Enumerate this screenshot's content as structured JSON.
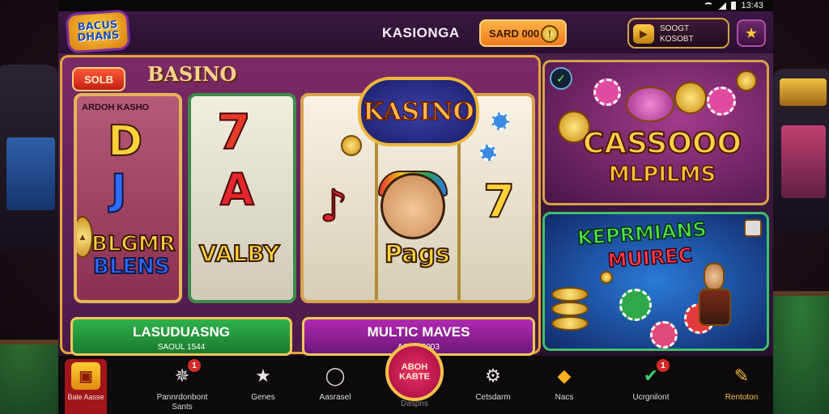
{
  "status_bar": {
    "time": "13:43"
  },
  "header": {
    "logo_line1": "BACUS",
    "logo_line2": "DHANS",
    "title": "KASIONGA",
    "coin_button_label": "SARD 000",
    "profile_line1": "SOOGT",
    "profile_line2": "KOSOBT",
    "icons": {
      "coin": "coin-icon",
      "profile": "ticket-icon",
      "star": "star-icon"
    }
  },
  "slot": {
    "badge": "SOLB",
    "top_name": "BASINO",
    "reel1_label": "ARDOH KASHO",
    "reel1_symbols": [
      "D",
      "J",
      "BLGMR",
      "BLENS"
    ],
    "reel2_symbols": [
      "7",
      "A",
      "VALBY"
    ],
    "kasino_badge": "KASINO",
    "reel3_symbols": [
      "7",
      "Pags"
    ]
  },
  "buttons": {
    "green_title": "LASUDUASNG",
    "green_sub": "SAOUL 1544",
    "purple_title": "MULTIC MAVES",
    "purple_sub": "AOUL 0003"
  },
  "promos": {
    "promo1_title": "CASSOOO",
    "promo1_sub": "MLPILMS",
    "promo2_title": "KEPRMIANS",
    "promo2_sub": "MUIREC"
  },
  "nav": {
    "home_label": "Bale Aasse",
    "items": [
      {
        "label": "Pannrdonbont Sants",
        "icon": "rocket-icon",
        "badge": "1"
      },
      {
        "label": "Genes",
        "icon": "star-icon"
      },
      {
        "label": "Aasrasel",
        "icon": "chat-bubble-icon"
      },
      {
        "label": "Cetsdarm",
        "icon": "gear-icon"
      },
      {
        "label": "Nacs",
        "icon": "diamond-icon"
      },
      {
        "label": "Ucrgnilont",
        "icon": "trophy-icon",
        "badge": "1"
      },
      {
        "label": "Rentoton",
        "icon": "thumbs-up-icon"
      }
    ],
    "center_line1": "ABOH",
    "center_line2": "KABTE",
    "center_label": "Daspns"
  },
  "colors": {
    "accent_gold": "#e5a53a",
    "accent_pink": "#e8306a",
    "bg_purple": "#48204a"
  }
}
